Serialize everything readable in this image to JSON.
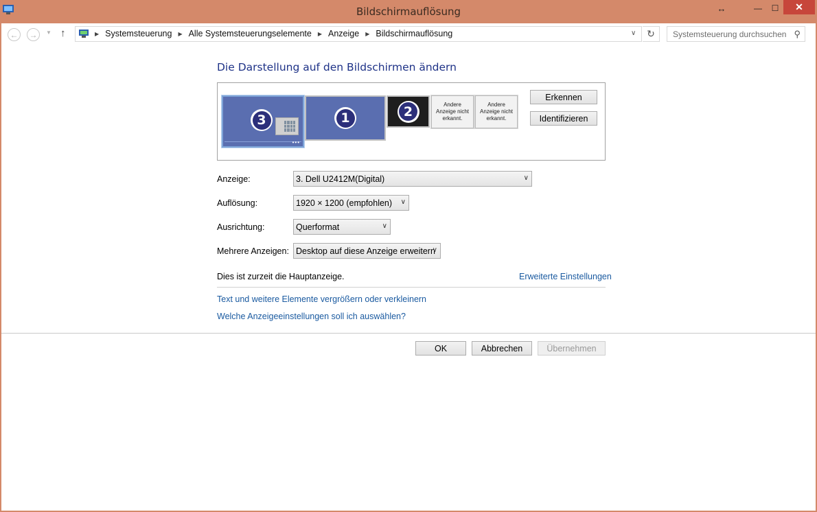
{
  "window": {
    "title": "Bildschirmauflösung",
    "controls": {
      "resize": "↔",
      "minimize": "—",
      "maximize": "☐",
      "close": "✕"
    }
  },
  "address": {
    "crumbs": [
      "Systemsteuerung",
      "Alle Systemsteuerungselemente",
      "Anzeige",
      "Bildschirmauflösung"
    ],
    "search_placeholder": "Systemsteuerung durchsuchen"
  },
  "heading": "Die Darstellung auf den Bildschirmen ändern",
  "monitors": {
    "m3": "3",
    "m1": "1",
    "m2": "2",
    "na4": "Andere Anzeige nicht erkannt.",
    "na5": "Andere Anzeige nicht erkannt."
  },
  "buttons": {
    "detect": "Erkennen",
    "identify": "Identifizieren",
    "ok": "OK",
    "cancel": "Abbrechen",
    "apply": "Übernehmen"
  },
  "form": {
    "display_label": "Anzeige:",
    "display_value": "3. Dell U2412M(Digital)",
    "resolution_label": "Auflösung:",
    "resolution_value": "1920 × 1200 (empfohlen)",
    "orientation_label": "Ausrichtung:",
    "orientation_value": "Querformat",
    "multi_label": "Mehrere Anzeigen:",
    "multi_value": "Desktop auf diese Anzeige erweitern"
  },
  "status": "Dies ist zurzeit die Hauptanzeige.",
  "links": {
    "advanced": "Erweiterte Einstellungen",
    "text_size": "Text und weitere Elemente vergrößern oder verkleinern",
    "which_settings": "Welche Anzeigeeinstellungen soll ich auswählen?"
  },
  "colors": {
    "titlebar": "#d4896a",
    "heading": "#1e3287",
    "link": "#1a5aa0",
    "monitor": "#5a6eb0"
  }
}
